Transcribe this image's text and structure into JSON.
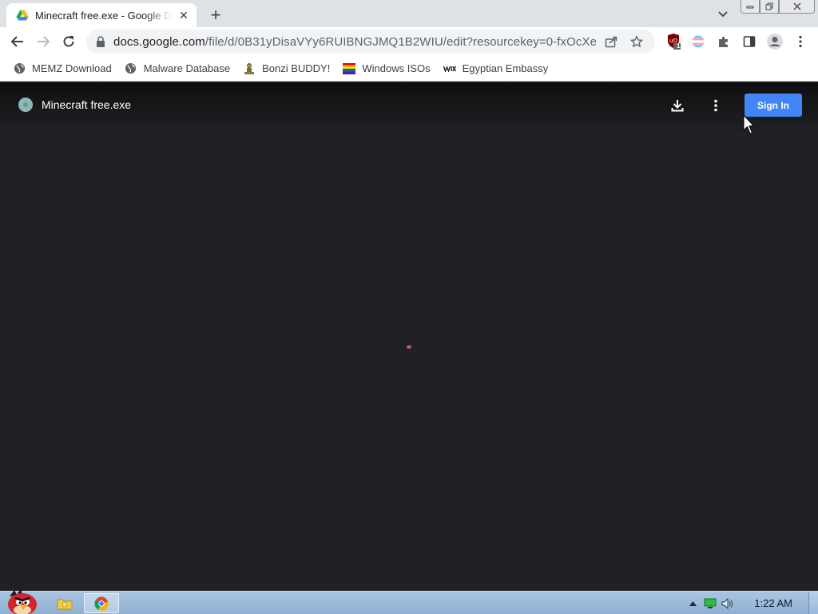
{
  "browser": {
    "tab": {
      "title": "Minecraft free.exe - Google Drive"
    },
    "url": {
      "host": "docs.google.com",
      "path": "/file/d/0B31yDisaVYy6RUIBNGJMQ1B2WIU/edit?resourcekey=0-fxOcXe..."
    },
    "extension_badge": "1",
    "bookmarks": [
      {
        "label": "MEMZ Download",
        "icon": "globe-icon"
      },
      {
        "label": "Malware Database",
        "icon": "globe-icon"
      },
      {
        "label": "Bonzi BUDDY!",
        "icon": "bonzi-icon"
      },
      {
        "label": "Windows ISOs",
        "icon": "rainbow-flag-icon"
      },
      {
        "label": "Egyptian Embassy",
        "icon": "wix-icon"
      }
    ]
  },
  "viewer": {
    "file_title": "Minecraft free.exe",
    "signin_label": "Sign In",
    "accent": "#4285f4"
  },
  "taskbar": {
    "clock": "1:22 AM"
  }
}
